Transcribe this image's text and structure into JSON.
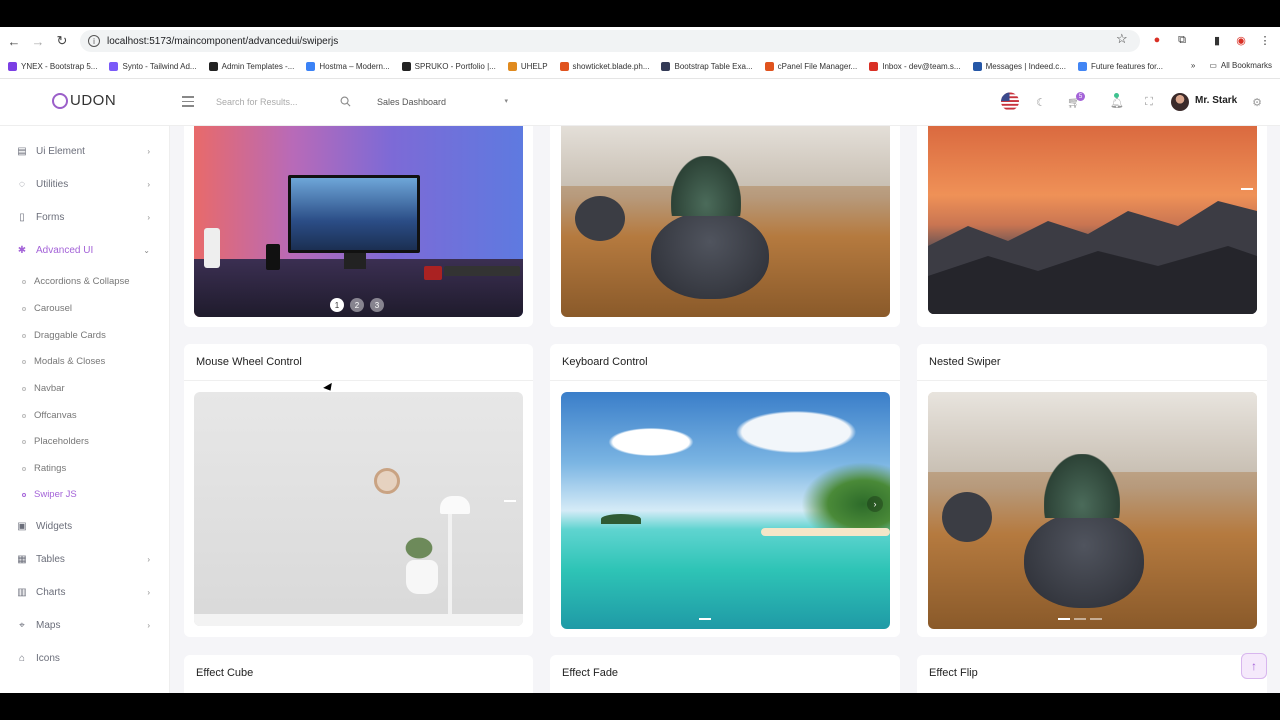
{
  "browser": {
    "url": "localhost:5173/maincomponent/advancedui/swiperjs",
    "bookmarks": [
      {
        "label": "YNEX - Bootstrap 5...",
        "color": "#7b3fe4"
      },
      {
        "label": "Synto - Tailwind Ad...",
        "color": "#7a5af8"
      },
      {
        "label": "Admin Templates -...",
        "color": "#222222"
      },
      {
        "label": "Hostma – Modern...",
        "color": "#3b82f6"
      },
      {
        "label": "SPRUKO - Portfolio |...",
        "color": "#222222"
      },
      {
        "label": "UHELP",
        "color": "#e08a1e"
      },
      {
        "label": "showticket.blade.ph...",
        "color": "#e0531e"
      },
      {
        "label": "Bootstrap Table Exa...",
        "color": "#333a56"
      },
      {
        "label": "cPanel File Manager...",
        "color": "#e0531e"
      },
      {
        "label": "Inbox - dev@team.s...",
        "color": "#d93025"
      },
      {
        "label": "Messages | Indeed.c...",
        "color": "#2557a7"
      },
      {
        "label": "Future features for...",
        "color": "#4285f4"
      }
    ],
    "all_bookmarks": "All Bookmarks"
  },
  "header": {
    "logo": "UDON",
    "search_placeholder": "Search for Results...",
    "dashboard_select": "Sales Dashboard",
    "cart_count": "5",
    "username": "Mr. Stark"
  },
  "sidebar": {
    "items": [
      {
        "label": "Ui Element",
        "icon": "box-icon"
      },
      {
        "label": "Utilities",
        "icon": "bulb-icon"
      },
      {
        "label": "Forms",
        "icon": "file-icon"
      },
      {
        "label": "Advanced UI",
        "icon": "sparkle-icon"
      },
      {
        "label": "Widgets",
        "icon": "gift-icon"
      },
      {
        "label": "Tables",
        "icon": "table-icon"
      },
      {
        "label": "Charts",
        "icon": "chart-icon"
      },
      {
        "label": "Maps",
        "icon": "map-pin-icon"
      },
      {
        "label": "Icons",
        "icon": "store-icon"
      }
    ],
    "sub_items": [
      "Accordions & Collapse",
      "Carousel",
      "Draggable Cards",
      "Modals & Closes",
      "Navbar",
      "Offcanvas",
      "Placeholders",
      "Ratings",
      "Swiper JS"
    ]
  },
  "cards": {
    "row2": [
      "Mouse Wheel Control",
      "Keyboard Control",
      "Nested Swiper"
    ],
    "row3": [
      "Effect Cube",
      "Effect Fade",
      "Effect Flip"
    ]
  },
  "pagination": [
    "1",
    "2",
    "3"
  ],
  "colors": {
    "accent": "#a463d8",
    "sidebar_text": "#6b6e7a",
    "page_bg": "#f5f5f8"
  }
}
